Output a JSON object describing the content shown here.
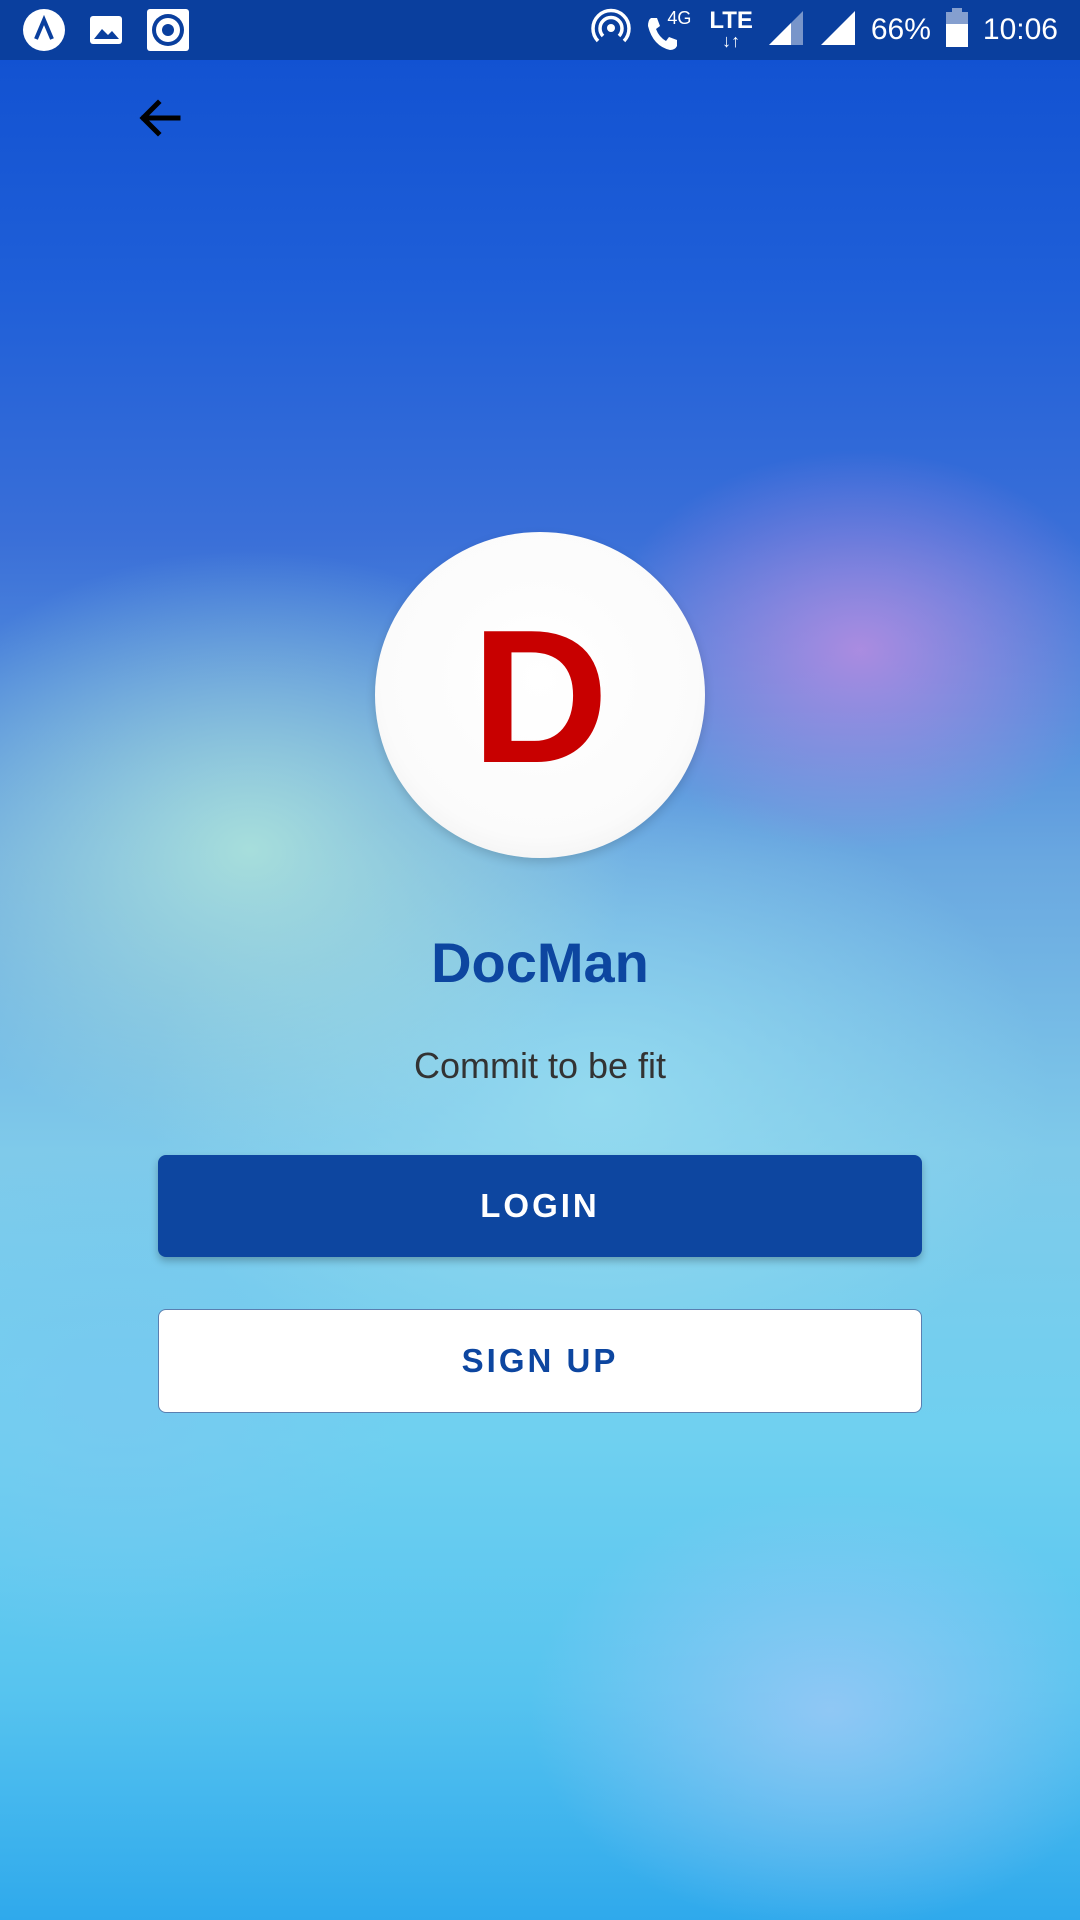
{
  "status_bar": {
    "battery": "66%",
    "time": "10:06",
    "network_4g": "4G",
    "network_lte": "LTE",
    "left_icons": [
      "app-notification-icon",
      "image-icon",
      "record-icon"
    ],
    "right_icons": [
      "hotspot-icon",
      "call-icon",
      "lte-data-icon",
      "signal-icon",
      "signal-icon",
      "battery-icon"
    ]
  },
  "header": {
    "back_icon": "arrow-left-icon"
  },
  "app": {
    "logo_letter": "D",
    "name": "DocMan",
    "tagline": "Commit to be fit"
  },
  "actions": {
    "login_label": "LOGIN",
    "signup_label": "SIGN UP"
  },
  "colors": {
    "primary": "#0d46a0",
    "logo_red": "#c80000",
    "status_bar": "#0a3f9e"
  }
}
